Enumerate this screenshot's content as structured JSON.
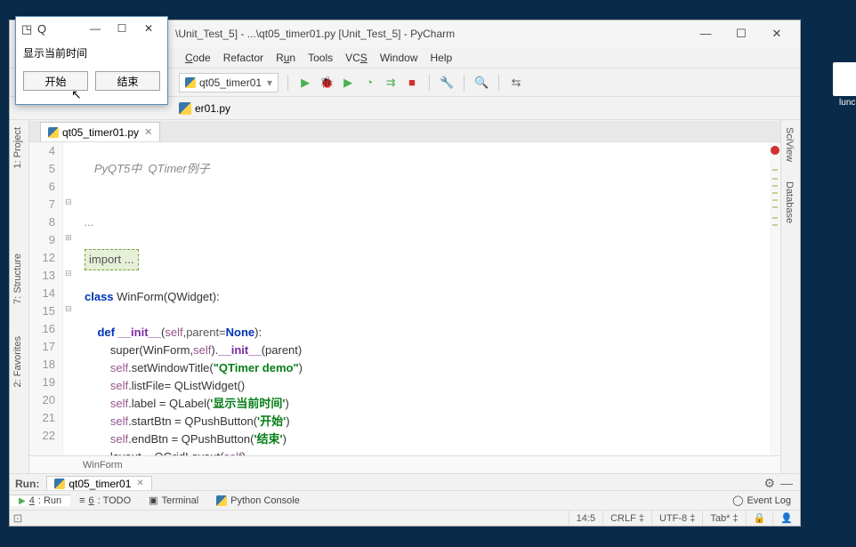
{
  "desktop": {
    "lunch_label": "lunch"
  },
  "pycharm": {
    "title": "\\Unit_Test_5] - ...\\qt05_timer01.py [Unit_Test_5] - PyCharm",
    "menu": {
      "code": "Code",
      "refactor": "Refactor",
      "run": "Run",
      "tools": "Tools",
      "vcs": "VCS",
      "window": "Window",
      "help": "Help"
    },
    "run_config": "qt05_timer01",
    "nav_file": "er01.py",
    "file_tab": "qt05_timer01.py",
    "breadcrumb": "WinForm",
    "left_tabs": {
      "project": "1: Project",
      "structure": "7: Structure",
      "favorites": "2: Favorites"
    },
    "right_tabs": {
      "sciview": "SciView",
      "database": "Database"
    },
    "run_panel": {
      "label": "Run:",
      "tab": "qt05_timer01"
    },
    "bottom": {
      "run": "4: Run",
      "todo": "6: TODO",
      "terminal": "Terminal",
      "python_console": "Python Console",
      "event_log": "Event Log"
    },
    "status": {
      "pos": "14:5",
      "le": "CRLF",
      "enc": "UTF-8",
      "indent": "Tab*"
    },
    "code": {
      "line_nums": [
        "4",
        "5",
        "6",
        "7",
        "8",
        "9",
        "12",
        "13",
        "14",
        "15",
        "16",
        "17",
        "18",
        "19",
        "20",
        "21",
        "22"
      ],
      "l4": "   PyQT5中  QTimer例子",
      "l7": "...",
      "l9": "import ...",
      "l13_a": "class",
      "l13_b": " WinForm(QWidget):",
      "l15_a": "def ",
      "l15_b": "__init__",
      "l15_c": "(",
      "l15_d": "self",
      "l15_e": ",parent=",
      "l15_f": "None",
      "l15_g": "):",
      "l16_a": "super(WinForm,",
      "l16_b": "self",
      "l16_c": ").",
      "l16_d": "__init__",
      "l16_e": "(parent)",
      "l17_a": "self",
      "l17_b": ".setWindowTitle(",
      "l17_c": "\"QTimer demo\"",
      "l17_d": ")",
      "l18_a": "self",
      "l18_b": ".listFile= QListWidget()",
      "l19_a": "self",
      "l19_b": ".label = QLabel(",
      "l19_c": "'显示当前时间'",
      "l19_d": ")",
      "l20_a": "self",
      "l20_b": ".startBtn = QPushButton(",
      "l20_c": "'开始'",
      "l20_d": ")",
      "l21_a": "self",
      "l21_b": ".endBtn = QPushButton(",
      "l21_c": "'结束'",
      "l21_d": ")",
      "l22_a": "layout = QGridLayout(",
      "l22_b": "self",
      "l22_c": ")"
    }
  },
  "qt_dialog": {
    "title": "Q",
    "label_text": "显示当前时间",
    "start_btn": "开始",
    "end_btn": "结束"
  }
}
